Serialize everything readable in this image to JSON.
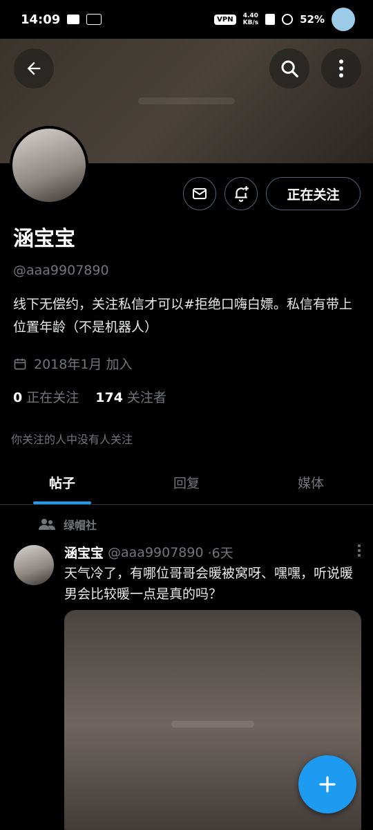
{
  "status_bar": {
    "time": "14:09",
    "vpn": "VPN",
    "speed_value": "4.40",
    "speed_unit": "KB/s",
    "battery": "52%"
  },
  "header": {
    "back_icon": "back-arrow-icon",
    "search_icon": "search-icon",
    "more_icon": "more-vertical-icon"
  },
  "profile": {
    "name": "涵宝宝",
    "handle": "@aaa9907890",
    "bio": "线下无偿约，关注私信才可以#拒绝口嗨白嫖。私信有带上位置年龄（不是机器人）",
    "joined": "2018年1月 加入",
    "following_count": "0",
    "following_label": "正在关注",
    "followers_count": "174",
    "followers_label": "关注者",
    "mutual_note": "你关注的人中没有人关注"
  },
  "actions": {
    "message_icon": "mail-icon",
    "notify_icon": "bell-plus-icon",
    "follow_label": "正在关注"
  },
  "tabs": [
    {
      "label": "帖子",
      "active": true
    },
    {
      "label": "回复",
      "active": false
    },
    {
      "label": "媒体",
      "active": false
    }
  ],
  "post": {
    "community": "绿帽社",
    "author": "涵宝宝",
    "handle": "@aaa9907890",
    "time": "·6天",
    "text": "天气冷了，有哪位哥哥会暖被窝呀、嘿嘿，听说暖男会比较暖一点是真的吗？"
  },
  "colors": {
    "accent": "#1d9bf0",
    "background": "#000000",
    "muted": "#71767b"
  },
  "fab_icon": "plus-icon"
}
